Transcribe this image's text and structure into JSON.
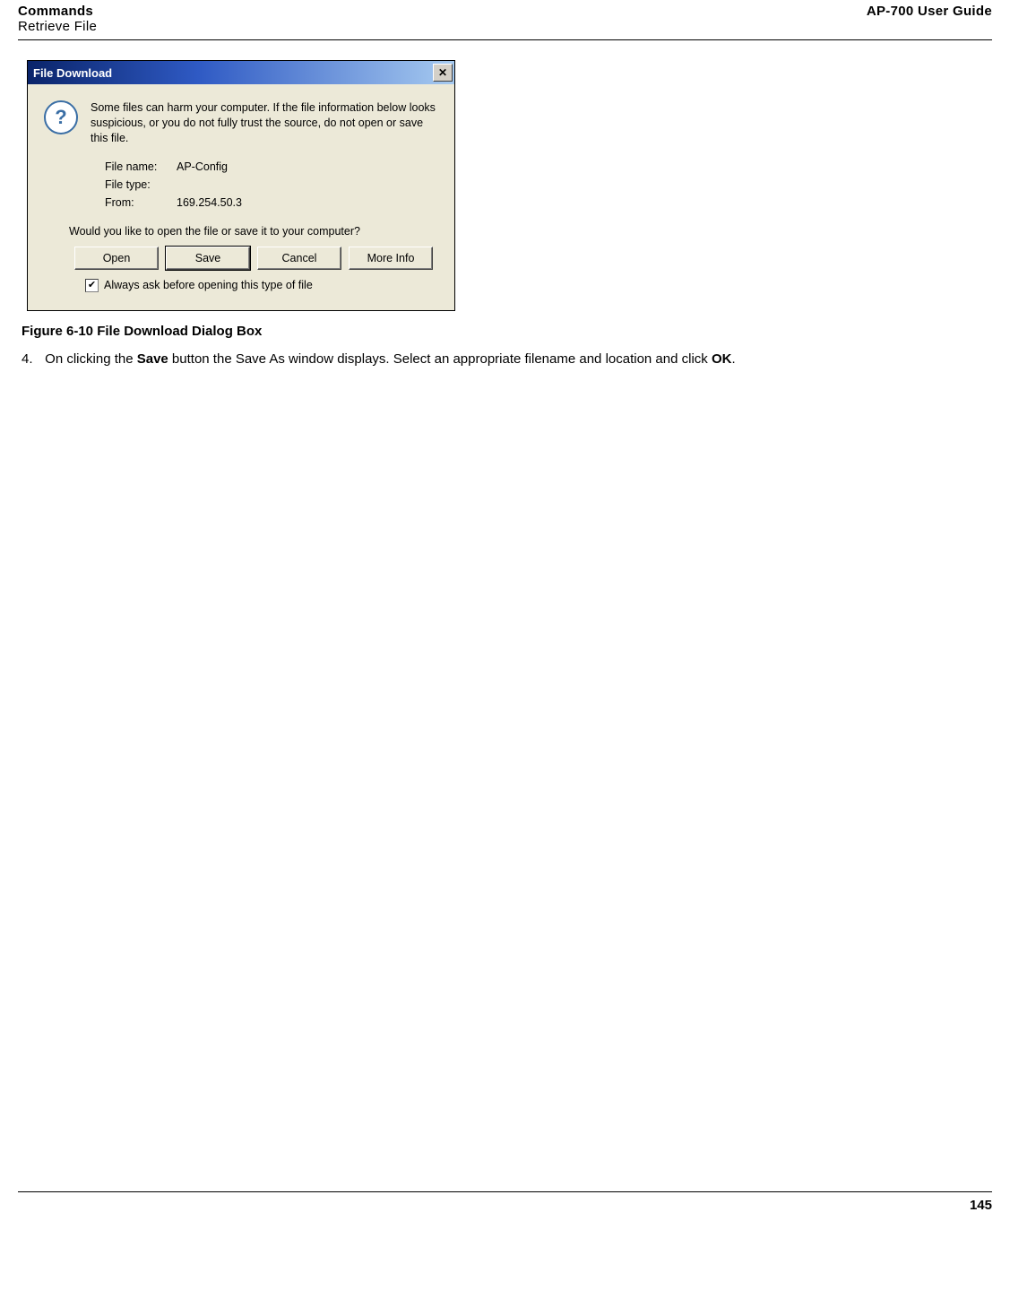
{
  "header": {
    "section": "Commands",
    "subsection": "Retrieve File",
    "guide": "AP-700 User Guide"
  },
  "dialog": {
    "title": "File Download",
    "close_label": "✕",
    "warning": "Some files can harm your computer. If the file information below looks suspicious, or you do not fully trust the source, do not open or save this file.",
    "filename_label": "File name:",
    "filename_value": "AP-Config",
    "filetype_label": "File type:",
    "filetype_value": "",
    "from_label": "From:",
    "from_value": "169.254.50.3",
    "prompt": "Would you like to open the file or save it to your computer?",
    "buttons": {
      "open": "Open",
      "save": "Save",
      "cancel": "Cancel",
      "more": "More Info"
    },
    "checkbox_label": "Always ask before opening this type of file",
    "checkbox_mark": "✔"
  },
  "figure_caption": "Figure 6-10 File Download Dialog Box",
  "step": {
    "number": "4.",
    "pre": "On clicking the ",
    "bold1": "Save",
    "mid": " button the Save As window displays. Select an appropriate filename and location and click ",
    "bold2": "OK",
    "post": "."
  },
  "page_number": "145"
}
